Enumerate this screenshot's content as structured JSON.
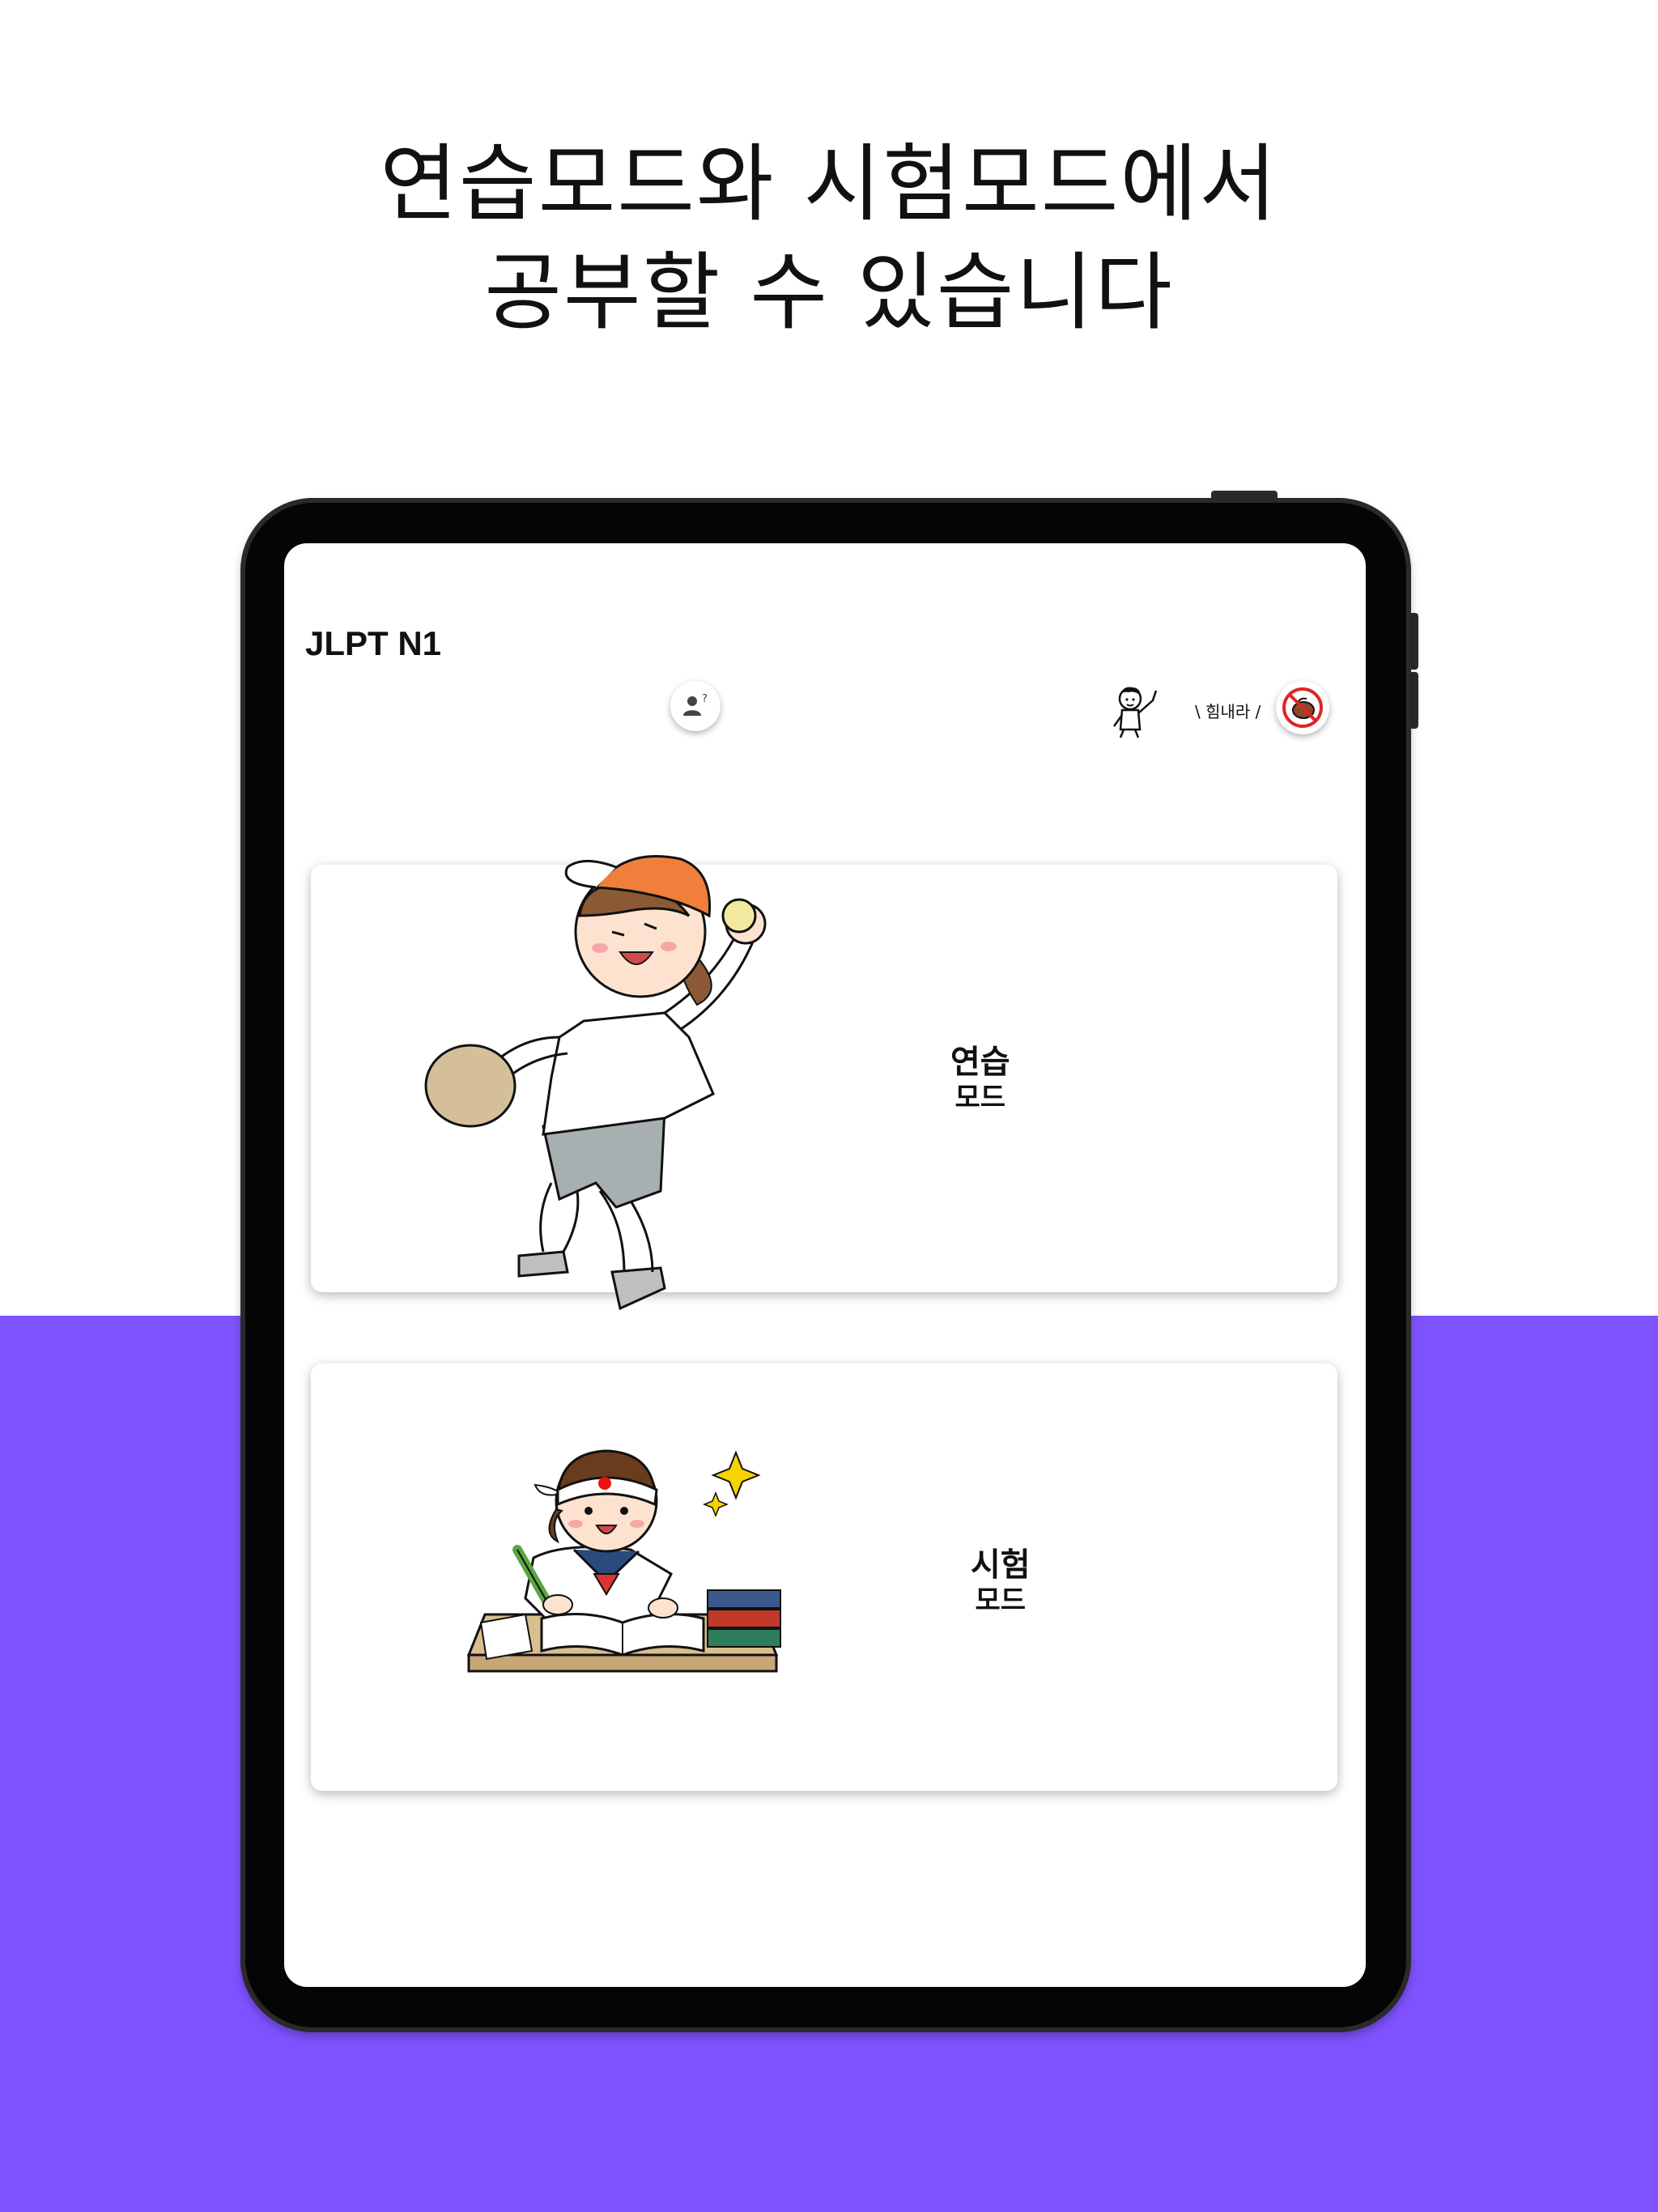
{
  "headline": {
    "line1": "연습모드와 시험모드에서",
    "line2": "공부할 수 있습니다"
  },
  "app": {
    "title": "JLPT N1",
    "cheer_text": "\\ 힘내라 /"
  },
  "modes": [
    {
      "title": "연습",
      "subtitle": "모드"
    },
    {
      "title": "시험",
      "subtitle": "모드"
    }
  ],
  "icons": {
    "profile": "person-question-icon",
    "no_ads": "no-ads-icon",
    "cheer": "cheering-boy-illustration"
  },
  "colors": {
    "accent": "#7f52ff",
    "cap": "#f07f3c",
    "book_blue": "#3a5a8c",
    "book_red": "#c0392b",
    "desk": "#c8a676"
  }
}
